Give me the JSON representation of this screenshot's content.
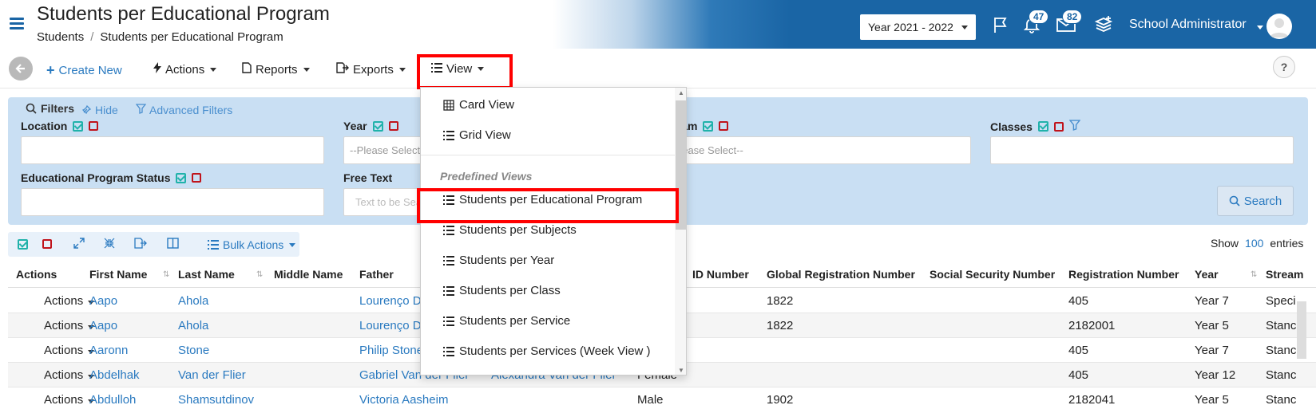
{
  "header": {
    "title": "Students per Educational Program",
    "breadcrumb": [
      "Students",
      "Students per Educational Program"
    ],
    "year_select": "Year 2021 - 2022",
    "notifications_count": "47",
    "messages_count": "82",
    "user_name": "School Administrator",
    "brand_color": "#1a65a5"
  },
  "toolbar": {
    "create_new": "Create New",
    "actions": "Actions",
    "reports": "Reports",
    "exports": "Exports",
    "view": "View",
    "help": "?"
  },
  "filters": {
    "title": "Filters",
    "hide": "Hide",
    "advanced": "Advanced Filters",
    "location_label": "Location",
    "year_label": "Year",
    "year_placeholder": "--Please Select--",
    "stream_label": "Stream",
    "stream_placeholder": "--Please Select--",
    "classes_label": "Classes",
    "program_status_label": "Educational Program Status",
    "free_text_label": "Free Text",
    "free_text_placeholder": "Text to be Searched",
    "search_button": "Search"
  },
  "bulk": {
    "bulk_actions": "Bulk Actions",
    "show": "Show",
    "entries_count": "100",
    "entries": "entries"
  },
  "table": {
    "columns": {
      "actions": "Actions",
      "first_name": "First Name",
      "last_name": "Last Name",
      "middle_name": "Middle Name",
      "father": "Father",
      "id_number": "ID Number",
      "global_reg": "Global Registration Number",
      "ssn": "Social Security Number",
      "reg_number": "Registration Number",
      "year": "Year",
      "stream": "Stream"
    },
    "rows": [
      {
        "action": "Actions",
        "first": "Aapo",
        "last": "Ahola",
        "father": "Lourenço D",
        "mother": "",
        "gender": "",
        "global": "1822",
        "reg": "405",
        "year": "Year 7",
        "stream": "Speci"
      },
      {
        "action": "Actions",
        "first": "Aapo",
        "last": "Ahola",
        "father": "Lourenço D",
        "mother": "",
        "gender": "",
        "global": "1822",
        "reg": "2182001",
        "year": "Year 5",
        "stream": "Stanc"
      },
      {
        "action": "Actions",
        "first": "Aaronn",
        "last": "Stone",
        "father": "Philip Stone",
        "mother": "",
        "gender": "",
        "global": "",
        "reg": "405",
        "year": "Year 7",
        "stream": "Stanc"
      },
      {
        "action": "Actions",
        "first": "Abdelhak",
        "last": "Van der Flier",
        "father": "Gabriel Van der Flier",
        "mother": "Alexandra Van der Flier",
        "gender": "Female",
        "global": "",
        "reg": "405",
        "year": "Year 12",
        "stream": "Stanc"
      },
      {
        "action": "Actions",
        "first": "Abdulloh",
        "last": "Shamsutdinov",
        "father": "Victoria Aasheim",
        "mother": "",
        "gender": "Male",
        "global": "1902",
        "reg": "2182041",
        "year": "Year 5",
        "stream": "Stanc"
      }
    ]
  },
  "view_menu": {
    "card_view": "Card View",
    "grid_view": "Grid View",
    "predefined_title": "Predefined Views",
    "predefined": [
      "Students per Educational Program",
      "Students per Subjects",
      "Students per Year",
      "Students per Class",
      "Students per Service",
      "Students per Services (Week View )"
    ]
  }
}
